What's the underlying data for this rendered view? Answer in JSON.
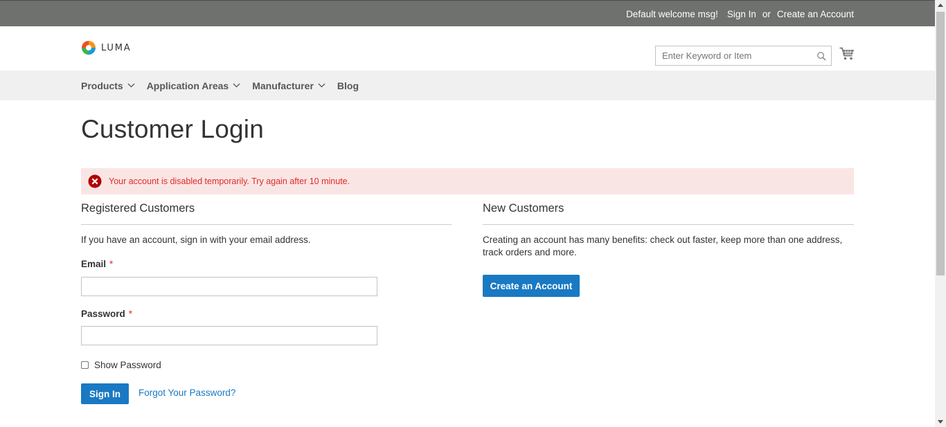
{
  "top_bar": {
    "welcome": "Default welcome msg!",
    "sign_in": "Sign In",
    "or": "or",
    "create_account": "Create an Account"
  },
  "header": {
    "logo_text": "LUMA",
    "search_placeholder": "Enter Keyword or Item",
    "icons": [
      "search-icon",
      "cart-icon"
    ]
  },
  "nav": {
    "items": [
      {
        "label": "Products",
        "has_dropdown": true
      },
      {
        "label": "Application Areas",
        "has_dropdown": true
      },
      {
        "label": "Manufacturer",
        "has_dropdown": true
      },
      {
        "label": "Blog",
        "has_dropdown": false
      }
    ]
  },
  "page_title": "Customer Login",
  "error_message": "Your account is disabled temporarily. Try again after 10 minute.",
  "registered": {
    "title": "Registered Customers",
    "note": "If you have an account, sign in with your email address.",
    "email_label": "Email",
    "password_label": "Password",
    "required_mark": "*",
    "email_value": "",
    "password_value": "",
    "show_password_label": "Show Password",
    "show_password_checked": false,
    "sign_in_button": "Sign In",
    "forgot_link": "Forgot Your Password?"
  },
  "new_customers": {
    "title": "New Customers",
    "note": "Creating an account has many benefits: check out faster, keep more than one address, track orders and more.",
    "create_button": "Create an Account"
  },
  "colors": {
    "top_bar_bg": "#6e716e",
    "nav_bg": "#f0f0f0",
    "primary": "#1979c3",
    "error_bg": "#fae5e5",
    "error_text": "#e02b27",
    "error_icon": "#b30000"
  }
}
